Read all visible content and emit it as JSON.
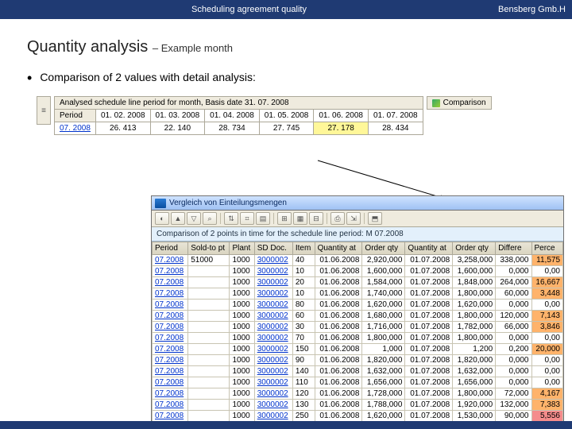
{
  "header": {
    "title": "Scheduling agreement quality",
    "right": "Bensberg Gmb.H"
  },
  "slide": {
    "title": "Quantity analysis",
    "subtitle": "– Example month",
    "bullet": "Comparison of 2 values with detail analysis:"
  },
  "upper": {
    "icon": "≡",
    "caption": "Analysed schedule line period for month, Basis date 31. 07. 2008",
    "period_label": "Period",
    "dates": [
      "01. 02. 2008",
      "01. 03. 2008",
      "01. 04. 2008",
      "01. 05. 2008",
      "01. 06. 2008",
      "01. 07. 2008"
    ],
    "period_value": "07. 2008",
    "values": [
      "26. 413",
      "22. 140",
      "28. 734",
      "27. 745",
      "27. 178",
      "28. 434"
    ],
    "compare_label": "Comparison"
  },
  "sap": {
    "window_title": "Vergleich von Einteilungsmengen",
    "subheader": "Comparison of 2 points in time for the schedule line period: M 07.2008",
    "toolbar_icons": [
      "◐",
      "▲",
      "▽",
      "⌕",
      "|",
      "⇅",
      "⌗",
      "▤",
      "|",
      "⊞",
      "▦",
      "⊟",
      "|",
      "⎙",
      "⇲",
      "|",
      "⬒"
    ],
    "columns": [
      "Period",
      "Sold-to pt",
      "Plant",
      "SD Doc.",
      "Item",
      "Quantity at",
      "Order qty",
      "Quantity at",
      "Order qty",
      "Differe",
      "Perce"
    ],
    "rows": [
      [
        "07.2008",
        "51000",
        "1000",
        "3000002",
        "40",
        "01.06.2008",
        "2,920,000",
        "01.07.2008",
        "3,258,000",
        "338,000",
        "11,575"
      ],
      [
        "07.2008",
        "",
        "1000",
        "3000002",
        "10",
        "01.06.2008",
        "1,600,000",
        "01.07.2008",
        "1,600,000",
        "0,000",
        "0,00"
      ],
      [
        "07.2008",
        "",
        "1000",
        "3000002",
        "20",
        "01.06.2008",
        "1,584,000",
        "01.07.2008",
        "1,848,000",
        "264,000",
        "16,667"
      ],
      [
        "07.2008",
        "",
        "1000",
        "3000002",
        "10",
        "01.06.2008",
        "1,740,000",
        "01.07.2008",
        "1,800,000",
        "60,000",
        "3,448"
      ],
      [
        "07.2008",
        "",
        "1000",
        "3000002",
        "80",
        "01.06.2008",
        "1,620,000",
        "01.07.2008",
        "1,620,000",
        "0,000",
        "0,00"
      ],
      [
        "07.2008",
        "",
        "1000",
        "3000002",
        "60",
        "01.06.2008",
        "1,680,000",
        "01.07.2008",
        "1,800,000",
        "120,000",
        "7,143"
      ],
      [
        "07.2008",
        "",
        "1000",
        "3000002",
        "30",
        "01.06.2008",
        "1,716,000",
        "01.07.2008",
        "1,782,000",
        "66,000",
        "3,846"
      ],
      [
        "07.2008",
        "",
        "1000",
        "3000002",
        "70",
        "01.06.2008",
        "1,800,000",
        "01.07.2008",
        "1,800,000",
        "0,000",
        "0,00"
      ],
      [
        "07.2008",
        "",
        "1000",
        "3000002",
        "150",
        "01.06.2008",
        "1,000",
        "01.07.2008",
        "1,200",
        "0,200",
        "20,000"
      ],
      [
        "07.2008",
        "",
        "1000",
        "3000002",
        "90",
        "01.06.2008",
        "1,820,000",
        "01.07.2008",
        "1,820,000",
        "0,000",
        "0,00"
      ],
      [
        "07.2008",
        "",
        "1000",
        "3000002",
        "140",
        "01.06.2008",
        "1,632,000",
        "01.07.2008",
        "1,632,000",
        "0,000",
        "0,00"
      ],
      [
        "07.2008",
        "",
        "1000",
        "3000002",
        "110",
        "01.06.2008",
        "1,656,000",
        "01.07.2008",
        "1,656,000",
        "0,000",
        "0,00"
      ],
      [
        "07.2008",
        "",
        "1000",
        "3000002",
        "120",
        "01.06.2008",
        "1,728,000",
        "01.07.2008",
        "1,800,000",
        "72,000",
        "4,167"
      ],
      [
        "07.2008",
        "",
        "1000",
        "3000002",
        "130",
        "01.06.2008",
        "1,788,000",
        "01.07.2008",
        "1,920,000",
        "132,000",
        "7,383"
      ],
      [
        "07.2008",
        "",
        "1000",
        "3000002",
        "250",
        "01.06.2008",
        "1,620,000",
        "01.07.2008",
        "1,530,000",
        "90,000",
        "5,556"
      ]
    ],
    "highlight_perce": {
      "0,00": "plain",
      "11,575": "o",
      "16,667": "o",
      "3,448": "o",
      "7,143": "o",
      "3,846": "o",
      "20,000": "o",
      "4,167": "o",
      "7,383": "o",
      "5,556": "r"
    }
  }
}
